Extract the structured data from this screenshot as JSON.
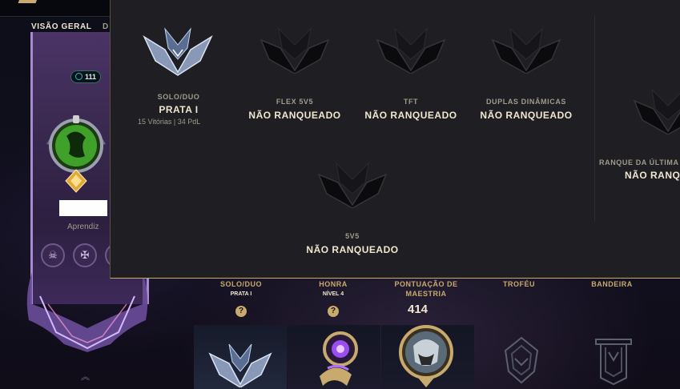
{
  "nav": {
    "tabs": [
      {
        "label": "VISÃO GERAL"
      },
      {
        "label": "D"
      }
    ]
  },
  "profile": {
    "level": "111",
    "title": "Aprendiz"
  },
  "ranked_popup": {
    "queues": [
      {
        "name": "SOLO/DUO",
        "rank": "PRATA I",
        "wins": "15 Vitórias",
        "lp": "34 PdL"
      },
      {
        "name": "FLEX 5V5",
        "rank": "NÃO RANQUEADO"
      },
      {
        "name": "TFT",
        "rank": "NÃO RANQUEADO"
      },
      {
        "name": "DUPLAS DINÂMICAS",
        "rank": "NÃO RANQUEADO"
      },
      {
        "name": "5V5",
        "rank": "NÃO RANQUEADO"
      }
    ],
    "last_season": {
      "label": "RANQUE DA ÚLTIMA",
      "rank": "NÃO RANQ"
    }
  },
  "summary": {
    "solo": {
      "label": "SOLO/DUO",
      "value": "PRATA I"
    },
    "honor": {
      "label": "HONRA",
      "value": "NÍVEL 4"
    },
    "mastery": {
      "label_line1": "PONTUAÇÃO DE",
      "label_line2": "MAESTRIA",
      "score": "414"
    },
    "trophy": {
      "label": "TROFÉU"
    },
    "banner": {
      "label": "BANDEIRA"
    },
    "help_glyph": "?"
  },
  "colors": {
    "accent": "#c8aa6e",
    "popup_bg": "#1e1e23",
    "text_light": "#f0e6d2",
    "text_muted": "#a09b8c"
  },
  "icons": [
    "crest-silver-icon",
    "crest-unranked-icon",
    "honor-icon",
    "mastery-champion-icon",
    "trophy-icon",
    "banner-icon",
    "help-icon",
    "chevron-up-icon"
  ]
}
